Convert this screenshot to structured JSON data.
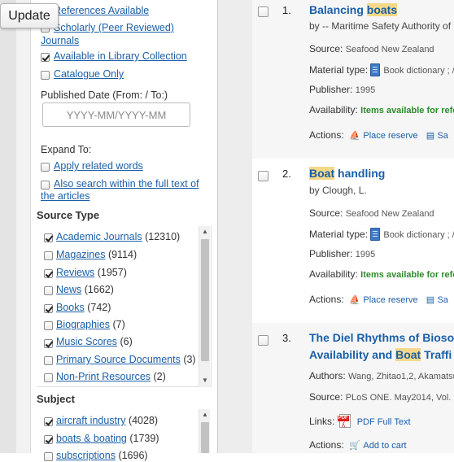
{
  "update_button": {
    "label": "Update"
  },
  "limit_options": [
    {
      "label": "References Available",
      "checked": false
    },
    {
      "label_line1": "Scholarly (Peer Reviewed)",
      "label_line2": "Journals",
      "checked": false
    },
    {
      "label": "Available in Library Collection",
      "checked": true
    },
    {
      "label": "Catalogue Only",
      "checked": false
    }
  ],
  "published_date": {
    "label": "Published Date (From: / To:)",
    "placeholder": "YYYY-MM/YYYY-MM"
  },
  "expand_to": {
    "label": "Expand To:",
    "options": [
      {
        "label": "Apply related words",
        "checked": false
      },
      {
        "label_line1": "Also search within the full text of",
        "label_line2": "the articles",
        "checked": false
      }
    ]
  },
  "source_type": {
    "heading": "Source Type",
    "items": [
      {
        "label": "Academic Journals",
        "count": "(12310)",
        "checked": true
      },
      {
        "label": "Magazines",
        "count": "(9114)",
        "checked": false
      },
      {
        "label": "Reviews",
        "count": "(1957)",
        "checked": true
      },
      {
        "label": "News",
        "count": "(1662)",
        "checked": false
      },
      {
        "label": "Books",
        "count": "(742)",
        "checked": true
      },
      {
        "label": "Biographies",
        "count": "(7)",
        "checked": false
      },
      {
        "label": "Music Scores",
        "count": "(6)",
        "checked": true
      },
      {
        "label": "Primary Source Documents",
        "count": "(3)",
        "checked": false
      },
      {
        "label": "Non-Print Resources",
        "count": "(2)",
        "checked": false
      }
    ]
  },
  "subject": {
    "heading": "Subject",
    "items": [
      {
        "label": "aircraft industry",
        "count": "(4028)",
        "checked": true
      },
      {
        "label": "boats & boating",
        "count": "(1739)",
        "checked": true
      },
      {
        "label": "subscriptions",
        "count": "(1696)",
        "checked": false
      }
    ]
  },
  "results": [
    {
      "number": "1.",
      "title_before": "Balancing ",
      "title_highlight": "boats",
      "title_after": "",
      "author": "by -- Maritime Safety Authority of",
      "source_label": "Source:",
      "source": "Seafood New Zealand",
      "material_label": "Material type:",
      "material": "Book dictionary ; /",
      "publisher_label": "Publisher:",
      "publisher": "1995",
      "availability_label": "Availability:",
      "availability": "Items available for refe",
      "actions_label": "Actions:",
      "action1": "Place reserve",
      "action2": "Sa"
    },
    {
      "number": "2.",
      "title_before": "",
      "title_highlight": "Boat",
      "title_after": " handling",
      "author": "by Clough, L.",
      "source_label": "Source:",
      "source": "Seafood New Zealand",
      "material_label": "Material type:",
      "material": "Book dictionary ; /",
      "publisher_label": "Publisher:",
      "publisher": "1995",
      "availability_label": "Availability:",
      "availability": "Items available for refe",
      "actions_label": "Actions:",
      "action1": "Place reserve",
      "action2": "Sa"
    },
    {
      "number": "3.",
      "title_line1": "The Diel Rhythms of Biosor",
      "title_line2_before": "Availability and ",
      "title_line2_highlight": "Boat",
      "title_line2_after": " Traffi",
      "authors_label": "Authors:",
      "authors": "Wang, Zhitao1,2, Akamatsu",
      "source_label": "Source:",
      "source": "PLoS ONE. May2014, Vol. 9",
      "links_label": "Links:",
      "link": "PDF Full Text",
      "actions_label": "Actions:",
      "action1": "Add to cart"
    }
  ]
}
